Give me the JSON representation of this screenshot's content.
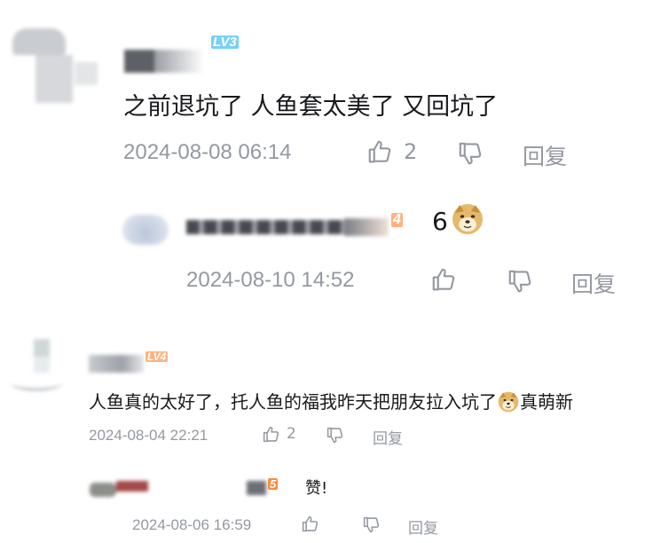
{
  "comments": [
    {
      "level": "LV3",
      "text": "之前退坑了 人鱼套太美了 又回坑了",
      "time": "2024-08-08 06:14",
      "likes": "2",
      "reply_label": "回复",
      "replies": [
        {
          "level": "4",
          "text": "6",
          "emoji": "doge-emoji",
          "time": "2024-08-10 14:52",
          "reply_label": "回复"
        }
      ]
    },
    {
      "level": "LV4",
      "text": "人鱼真的太好了，托人鱼的福我昨天把朋友拉入坑了",
      "text_tail": "真萌新",
      "emoji": "doge-emoji",
      "time": "2024-08-04 22:21",
      "likes": "2",
      "reply_label": "回复",
      "replies": [
        {
          "level": "5",
          "text": "赞!",
          "time": "2024-08-06 16:59",
          "reply_label": "回复"
        }
      ]
    }
  ],
  "colors": {
    "text": "#18191c",
    "meta": "#9499a0",
    "level3": "#77d0f7",
    "level4": "#ffb27f",
    "level5": "#ff8a3d"
  }
}
